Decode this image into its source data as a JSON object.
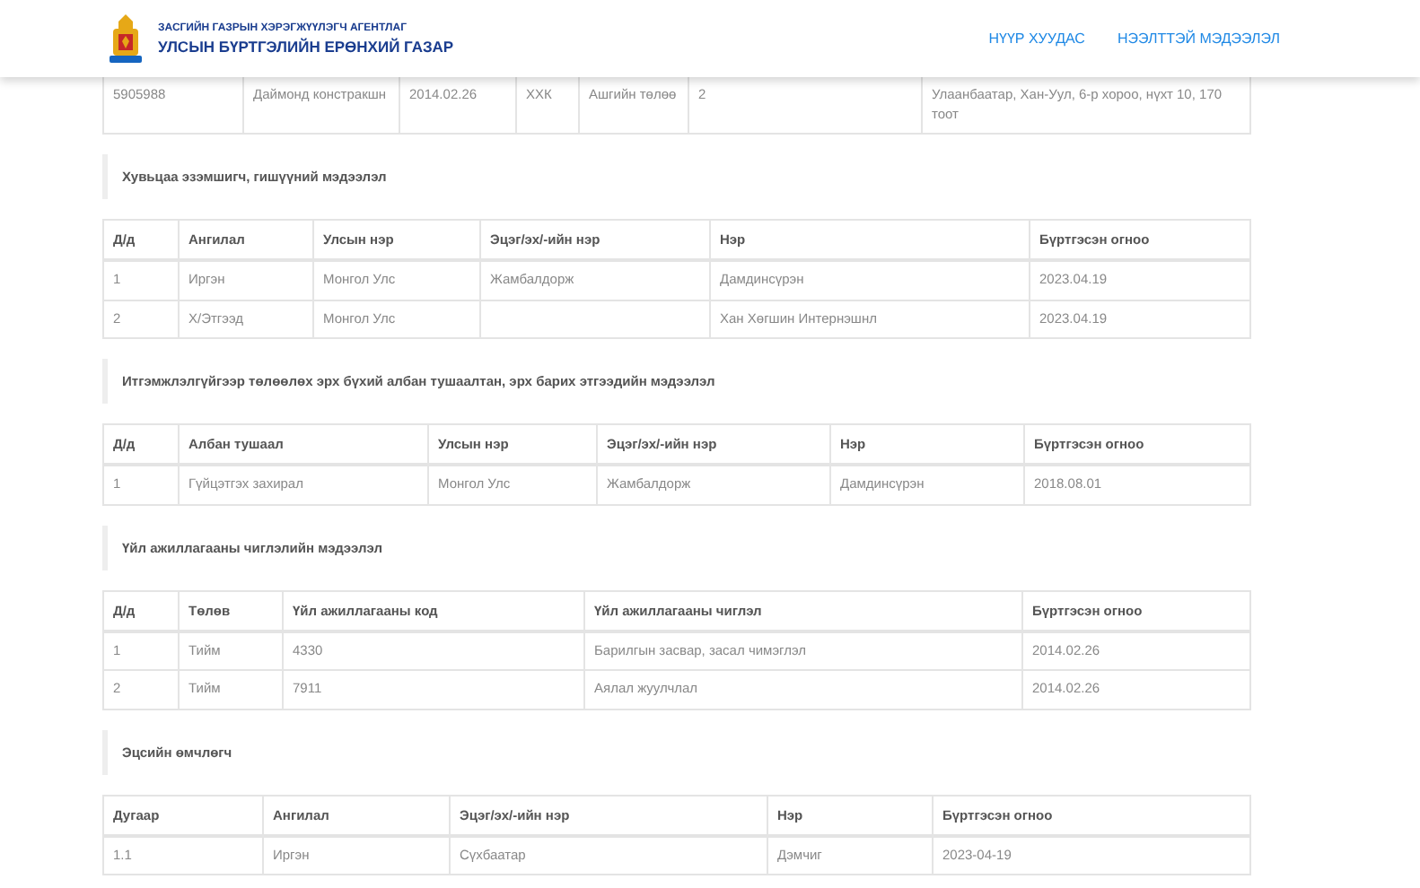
{
  "header": {
    "agency_line": "ЗАСГИЙН ГАЗРЫН ХЭРЭГЖҮҮЛЭГЧ АГЕНТЛАГ",
    "org_name": "УЛСЫН БҮРТГЭЛИЙН ЕРӨНХИЙ ГАЗАР",
    "nav": [
      "НҮҮР ХУУДАС",
      "НЭЭЛТТЭЙ МЭДЭЭЛЭЛ"
    ]
  },
  "company_table": {
    "rows": [
      [
        "5905988",
        "Даймонд констракшн",
        "2014.02.26",
        "ХХК",
        "Ашгийн төлөө",
        "2",
        "Улаанбаатар, Хан-Уул, 6-р хороо, нүхт 10, 170 тоот"
      ]
    ]
  },
  "sections": [
    {
      "title": "Хувьцаа эзэмшигч, гишүүний мэдээлэл",
      "columns": [
        "Д/д",
        "Ангилал",
        "Улсын нэр",
        "Эцэг/эх/-ийн нэр",
        "Нэр",
        "Бүртгэсэн огноо"
      ],
      "rows": [
        [
          "1",
          "Иргэн",
          "Монгол Улс",
          "Жамбалдорж",
          "Дамдинсүрэн",
          "2023.04.19"
        ],
        [
          "2",
          "Х/Этгээд",
          "Монгол Улс",
          "",
          "Хан Хөгшин Интернэшнл",
          "2023.04.19"
        ]
      ]
    },
    {
      "title": "Итгэмжлэлгүйгээр төлөөлөх эрх бүхий албан тушаалтан, эрх барих этгээдийн мэдээлэл",
      "columns": [
        "Д/д",
        "Албан тушаал",
        "Улсын нэр",
        "Эцэг/эх/-ийн нэр",
        "Нэр",
        "Бүртгэсэн огноо"
      ],
      "rows": [
        [
          "1",
          "Гүйцэтгэх захирал",
          "Монгол Улс",
          "Жамбалдорж",
          "Дамдинсүрэн",
          "2018.08.01"
        ]
      ]
    },
    {
      "title": "Үйл ажиллагааны чиглэлийн мэдээлэл",
      "columns": [
        "Д/д",
        "Төлөв",
        "Үйл ажиллагааны код",
        "Үйл ажиллагааны чиглэл",
        "Бүртгэсэн огноо"
      ],
      "rows": [
        [
          "1",
          "Тийм",
          "4330",
          "Барилгын засвар, засал чимэглэл",
          "2014.02.26"
        ],
        [
          "2",
          "Тийм",
          "7911",
          "Аялал жуулчлал",
          "2014.02.26"
        ]
      ]
    },
    {
      "title": "Эцсийн өмчлөгч",
      "columns": [
        "Дугаар",
        "Ангилал",
        "Эцэг/эх/-ийн нэр",
        "Нэр",
        "Бүртгэсэн огноо"
      ],
      "rows": [
        [
          "1.1",
          "Иргэн",
          "Сүхбаатар",
          "Дэмчиг",
          "2023-04-19"
        ]
      ]
    }
  ]
}
